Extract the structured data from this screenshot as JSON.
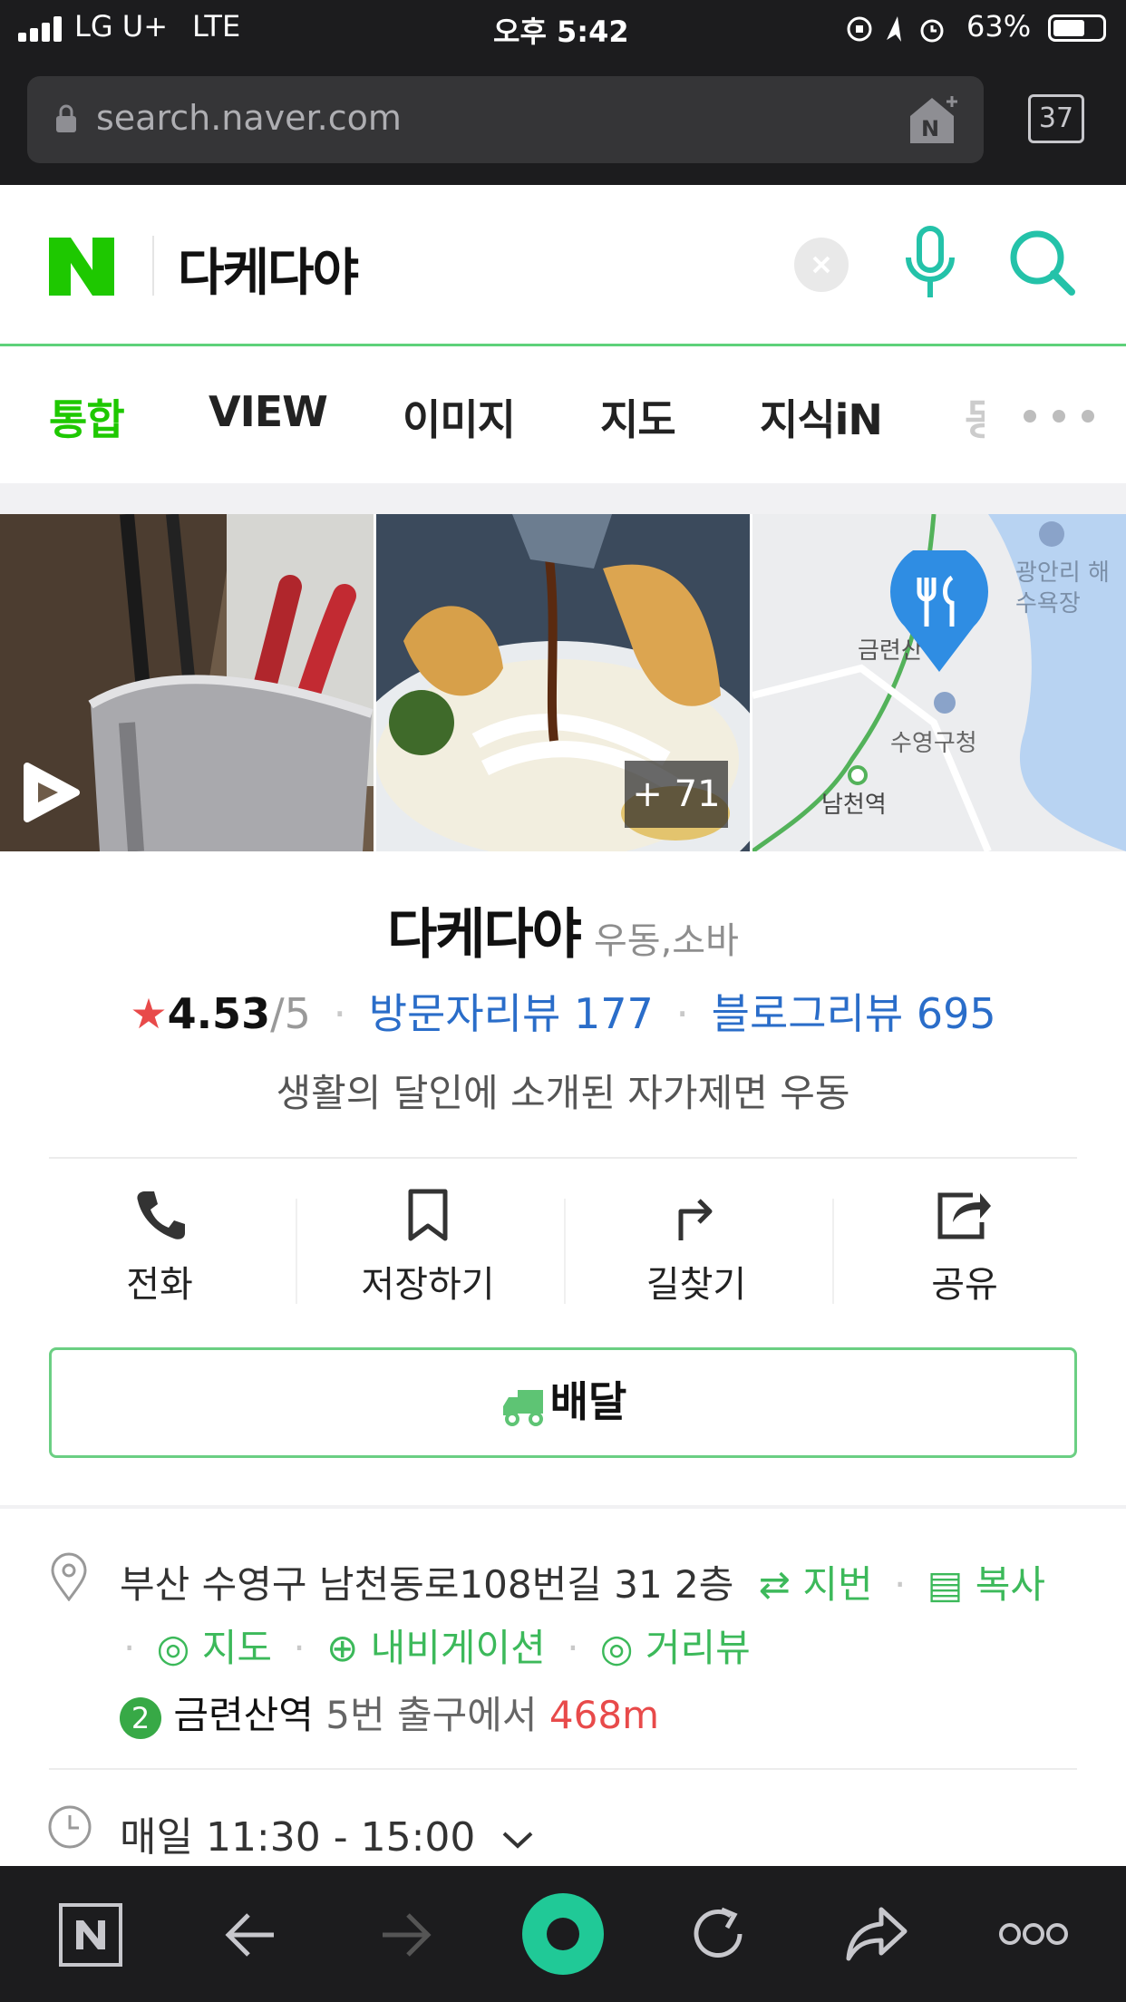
{
  "status_bar": {
    "carrier": "LG U+",
    "network": "LTE",
    "time": "오후 5:42",
    "battery": "63%"
  },
  "browser": {
    "url": "search.naver.com",
    "tab_count": "37"
  },
  "search": {
    "query": "다케다야"
  },
  "tabs": [
    {
      "label": "통합",
      "active": true
    },
    {
      "label": "VIEW"
    },
    {
      "label": "이미지"
    },
    {
      "label": "지도"
    },
    {
      "label": "지식iN"
    },
    {
      "label": "동"
    }
  ],
  "images": {
    "more_count": "+ 71",
    "map_labels": [
      "광안리 해수욕장",
      "금련산",
      "수영구청",
      "남천역"
    ]
  },
  "place": {
    "name": "다케다야",
    "category": "우동,소바",
    "rating": "4.53",
    "rating_max": "/5",
    "visitor_reviews": "방문자리뷰 177",
    "blog_reviews": "블로그리뷰 695",
    "tagline": "생활의 달인에 소개된 자가제면 우동"
  },
  "actions": [
    {
      "label": "전화",
      "icon": "phone-icon"
    },
    {
      "label": "저장하기",
      "icon": "bookmark-icon"
    },
    {
      "label": "길찾기",
      "icon": "directions-icon"
    },
    {
      "label": "공유",
      "icon": "share-icon"
    }
  ],
  "delivery_label": "배달",
  "address": {
    "text": "부산 수영구 남천동로108번길 31 2층",
    "lot_label": "지번",
    "copy_label": "복사",
    "map_label": "지도",
    "navi_label": "내비게이션",
    "street_label": "거리뷰"
  },
  "subway": {
    "line": "2",
    "station": "금련산역",
    "exit": "5번 출구에서",
    "distance": "468m"
  },
  "hours": {
    "text": "매일 11:30 - 15:00"
  },
  "colors": {
    "naver_green": "#1ec800",
    "link_blue": "#2a6dc9",
    "red": "#e84a4a"
  }
}
